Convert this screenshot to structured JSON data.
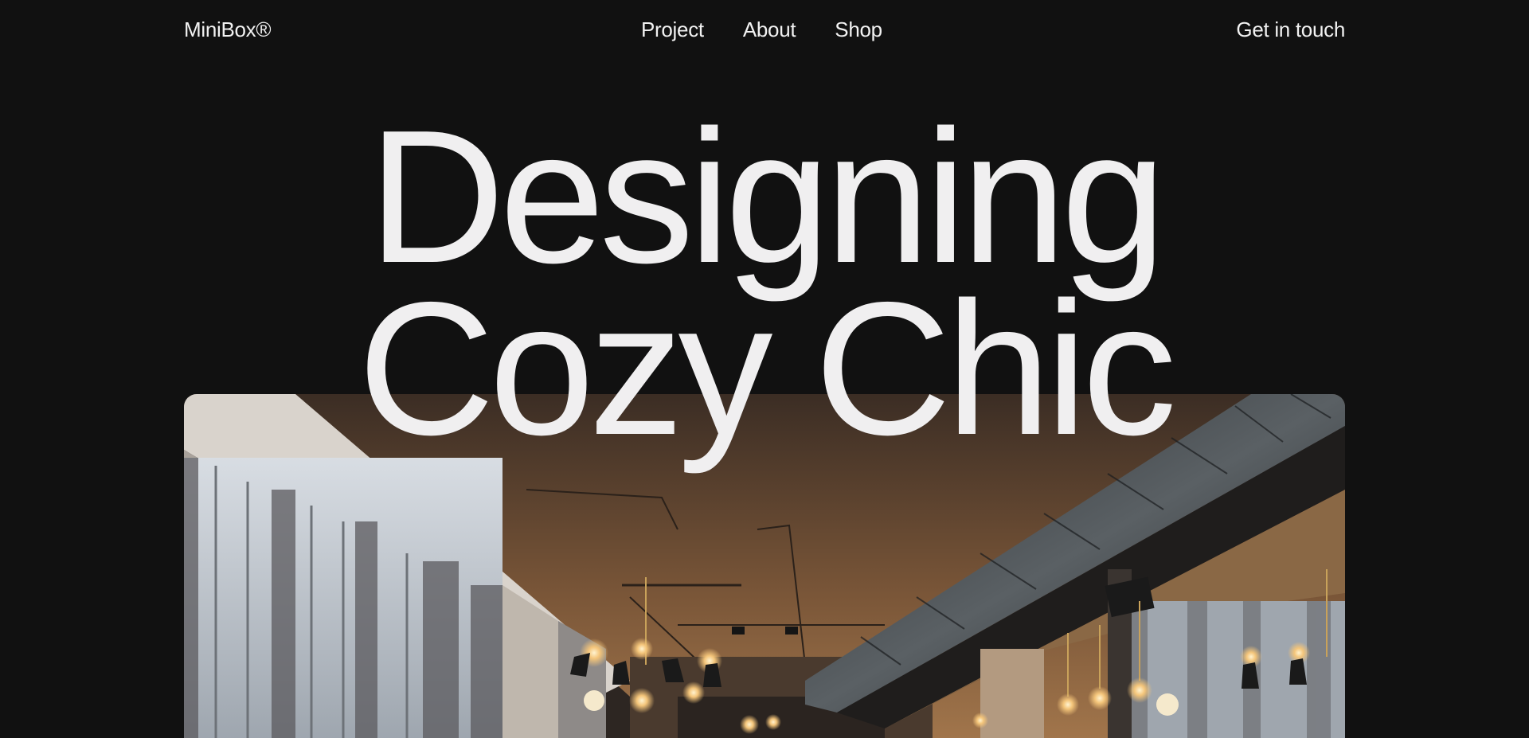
{
  "nav": {
    "brand": "MiniBox®",
    "links": [
      {
        "label": "Project"
      },
      {
        "label": "About"
      },
      {
        "label": "Shop"
      }
    ],
    "cta": "Get in touch"
  },
  "hero": {
    "title_line1": "Designing",
    "title_line2": "Cozy Chic"
  },
  "colors": {
    "background": "#111111",
    "text": "#f2f2f2"
  }
}
